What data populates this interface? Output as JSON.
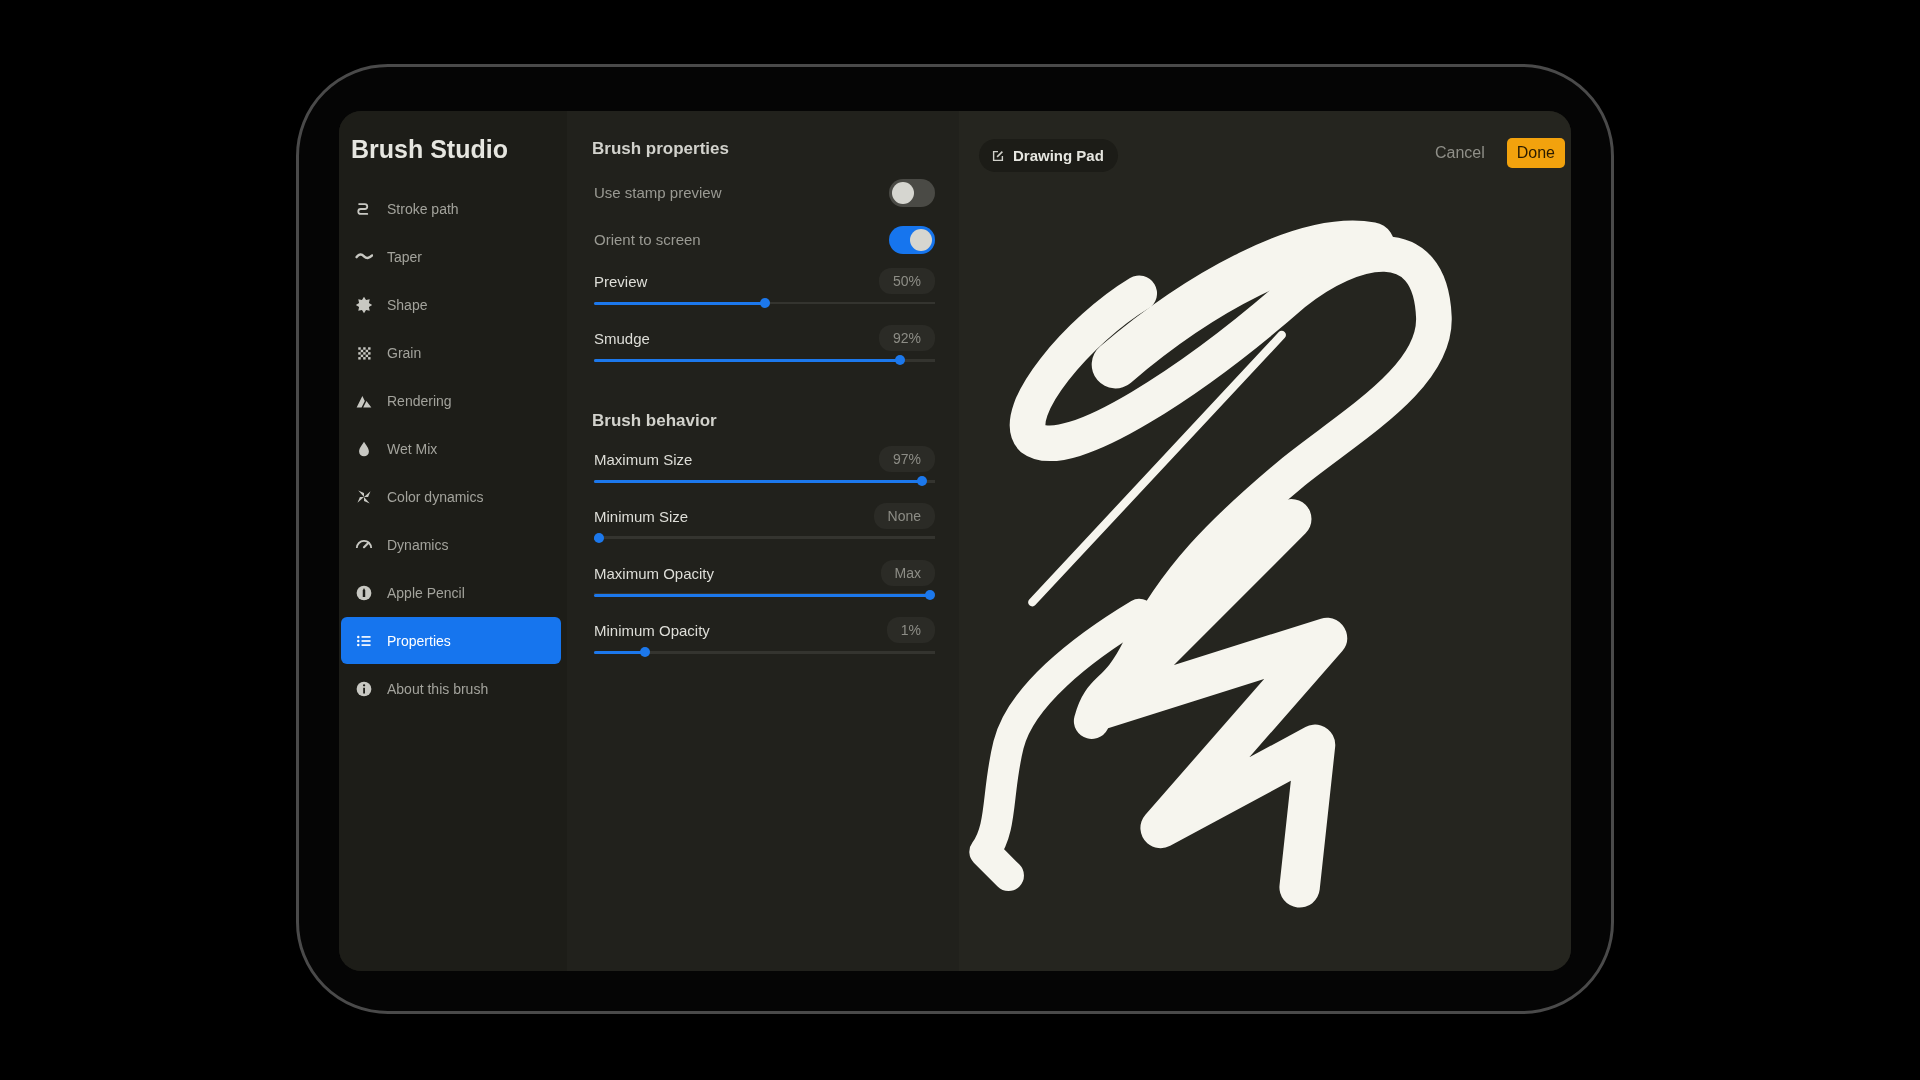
{
  "sidebar": {
    "title": "Brush Studio",
    "items": [
      {
        "label": "Stroke path",
        "selected": false
      },
      {
        "label": "Taper",
        "selected": false
      },
      {
        "label": "Shape",
        "selected": false
      },
      {
        "label": "Grain",
        "selected": false
      },
      {
        "label": "Rendering",
        "selected": false
      },
      {
        "label": "Wet Mix",
        "selected": false
      },
      {
        "label": "Color dynamics",
        "selected": false
      },
      {
        "label": "Dynamics",
        "selected": false
      },
      {
        "label": "Apple Pencil",
        "selected": false
      },
      {
        "label": "Properties",
        "selected": true
      },
      {
        "label": "About this brush",
        "selected": false
      }
    ]
  },
  "sections": [
    {
      "title": "Brush properties",
      "rows": [
        {
          "kind": "toggle",
          "label": "Use stamp preview",
          "on": false
        },
        {
          "kind": "toggle",
          "label": "Orient to screen",
          "on": true
        },
        {
          "kind": "slider",
          "label": "Preview",
          "reading": "50%",
          "level": 0.5
        },
        {
          "kind": "slider",
          "label": "Smudge",
          "reading": "92%",
          "level": 0.91
        }
      ]
    },
    {
      "title": "Brush behavior",
      "rows": [
        {
          "kind": "slider",
          "label": "Maximum Size",
          "reading": "97%",
          "level": 0.975
        },
        {
          "kind": "slider",
          "label": "Minimum Size",
          "reading": "None",
          "level": 0.0
        },
        {
          "kind": "slider",
          "label": "Maximum Opacity",
          "reading": "Max",
          "level": 1.0
        },
        {
          "kind": "slider",
          "label": "Minimum Opacity",
          "reading": "1%",
          "level": 0.14
        }
      ]
    }
  ],
  "drawing_pad": {
    "title": "Drawing Pad",
    "cancel": "Cancel",
    "done": "Done"
  }
}
